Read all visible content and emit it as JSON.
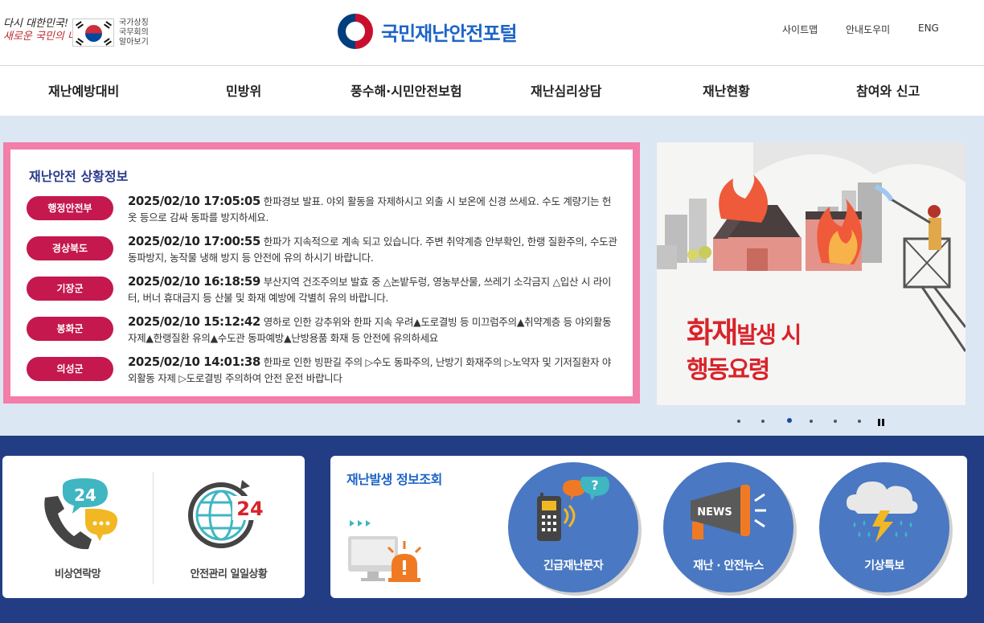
{
  "header": {
    "slogan_line1": "다시 대한민국!",
    "slogan_line2": "새로운 국민의 나라",
    "gov_link_lines": [
      "국가상징",
      "국무회의",
      "알아보기"
    ],
    "site_title": "국민재난안전포털",
    "utility_links": [
      "사이트맵",
      "안내도우미",
      "ENG"
    ]
  },
  "gnb": {
    "items": [
      "재난예방대비",
      "민방위",
      "풍수해·시민안전보험",
      "재난심리상담",
      "재난현황",
      "참여와 신고"
    ]
  },
  "situation": {
    "title": "재난안전 상황정보",
    "items": [
      {
        "agency": "행정안전부",
        "time": "2025/02/10 17:05:05",
        "message": "한파경보 발표. 야외 활동을 자제하시고 외출 시 보온에 신경 쓰세요. 수도 계량기는 헌 옷 등으로 감싸 동파를 방지하세요."
      },
      {
        "agency": "경상북도",
        "time": "2025/02/10 17:00:55",
        "message": "한파가 지속적으로 계속 되고 있습니다. 주변 취약계층 안부확인, 한랭 질환주의, 수도관 동파방지, 농작물 냉해 방지 등 안전에 유의 하시기 바랍니다."
      },
      {
        "agency": "기장군",
        "time": "2025/02/10 16:18:59",
        "message": "부산지역 건조주의보 발효 중 △논밭두렁, 영농부산물, 쓰레기 소각금지 △입산 시 라이터, 버너 휴대금지 등 산불 및 화재 예방에 각별히 유의 바랍니다."
      },
      {
        "agency": "봉화군",
        "time": "2025/02/10 15:12:42",
        "message": "영하로 인한 강추위와 한파 지속 우려▲도로결빙 등 미끄럼주의▲취약계층 등 야외활동 자제▲한랭질환 유의▲수도관 동파예방▲난방용품 화재 등 안전에 유의하세요"
      },
      {
        "agency": "의성군",
        "time": "2025/02/10 14:01:38",
        "message": "한파로 인한 빙판길 주의 ▷수도 동파주의, 난방기 화재주의 ▷노약자 및 기저질환자 야외활동 자제 ▷도로결빙 주의하여 안전 운전 바랍니다"
      }
    ]
  },
  "banner": {
    "title_big": "화재",
    "title_rest": "발생 시",
    "subtitle": "행동요령",
    "slides": 6,
    "active_slide": 3,
    "colors": {
      "accent": "#d8232a"
    }
  },
  "quick_links": [
    {
      "label": "비상연락망",
      "icon": "phone-24-icon"
    },
    {
      "label": "안전관리 일일상황",
      "icon": "globe-24-icon"
    }
  ],
  "disaster_info": {
    "title": "재난발생 정보조회",
    "buttons": [
      {
        "label": "긴급재난문자",
        "icon": "walkie-talkie-icon"
      },
      {
        "label": "재난 · 안전뉴스",
        "icon": "megaphone-news-icon"
      },
      {
        "label": "기상특보",
        "icon": "storm-cloud-icon"
      }
    ]
  },
  "colors": {
    "brand_blue": "#1d64c8",
    "badge_red": "#c4184f",
    "frame_pink": "#f27ea9",
    "lower_band": "#223d84",
    "circle_blue": "#4a78c2"
  }
}
